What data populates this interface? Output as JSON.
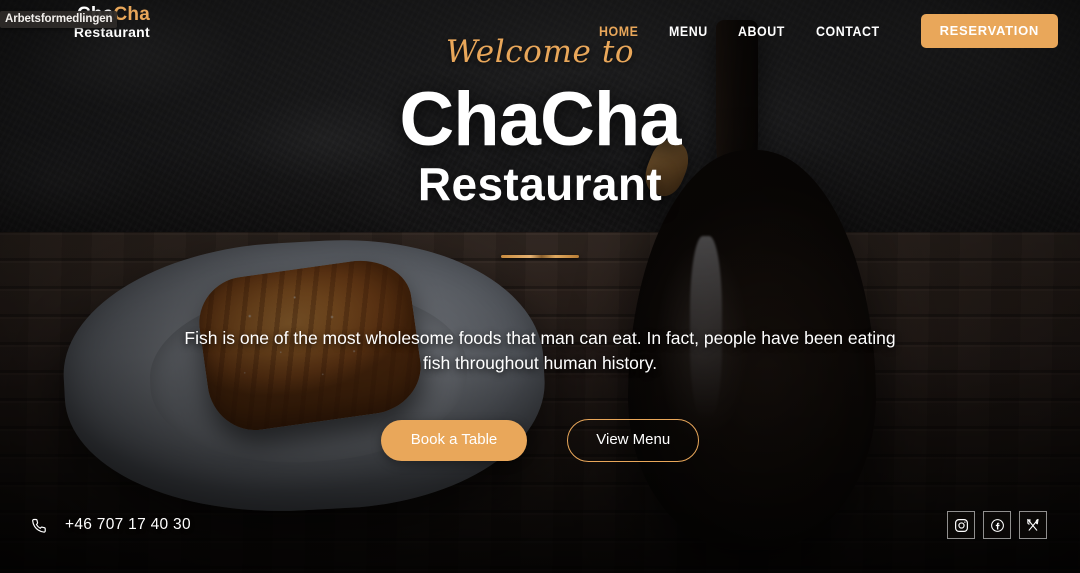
{
  "overlay": {
    "autofill_chip": "Arbetsformedlingen"
  },
  "header": {
    "logo": {
      "part_one": "Cha",
      "part_two": "Cha",
      "subtitle": "Restaurant"
    },
    "nav": [
      {
        "label": "HOME",
        "active": true
      },
      {
        "label": "MENU",
        "active": false
      },
      {
        "label": "ABOUT",
        "active": false
      },
      {
        "label": "CONTACT",
        "active": false
      }
    ],
    "reservation_button": "RESERVATION"
  },
  "hero": {
    "welcome": "Welcome to",
    "title": "ChaCha",
    "subtitle": "Restaurant",
    "tagline": "Fish is one of the most wholesome foods that man can eat. In fact, people have been eating fish throughout human history.",
    "primary_cta": "Book a Table",
    "secondary_cta": "View Menu"
  },
  "footer": {
    "phone": "+46 707 17 40 30",
    "socials": [
      "instagram-icon",
      "facebook-icon",
      "cutlery-icon"
    ]
  },
  "colors": {
    "accent": "#e9a75a",
    "text": "#ffffff",
    "wall": "#343436",
    "wood": "#40302a"
  }
}
